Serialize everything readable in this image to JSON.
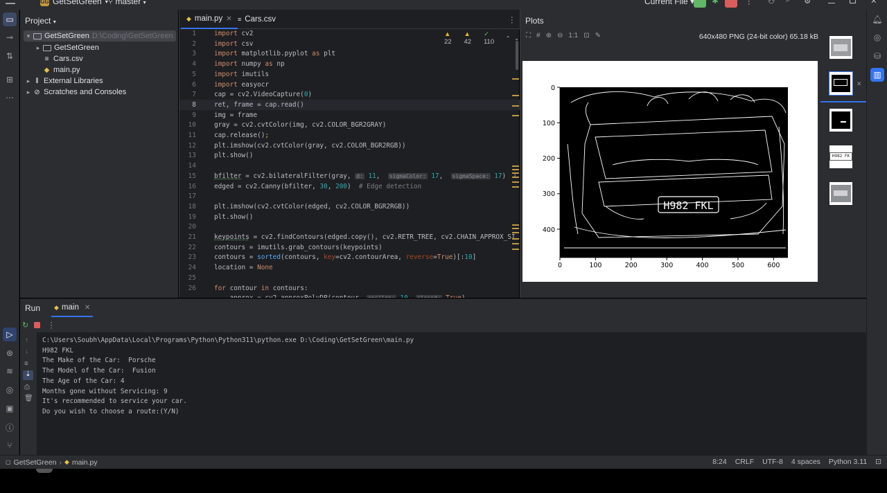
{
  "titlebar": {
    "project_badge": "GG",
    "project": "GetSetGreen",
    "branch": "master",
    "run_config": "Current File"
  },
  "project_panel": {
    "title": "Project",
    "tree": [
      {
        "label": "GetSetGreen",
        "path": "D:\\Coding\\GetSetGreen",
        "type": "folder",
        "expanded": true
      },
      {
        "label": "GetSetGreen",
        "type": "folder",
        "expanded": false
      },
      {
        "label": "Cars.csv",
        "type": "csv"
      },
      {
        "label": "main.py",
        "type": "python"
      },
      {
        "label": "External Libraries",
        "type": "library",
        "expanded": false
      },
      {
        "label": "Scratches and Consoles",
        "type": "scratch",
        "expanded": false
      }
    ]
  },
  "editor": {
    "tabs": [
      {
        "label": "main.py",
        "active": true
      },
      {
        "label": "Cars.csv",
        "active": false
      }
    ],
    "inspections": {
      "warnings": "22",
      "weak": "42",
      "ok": "110"
    },
    "current_line": 8,
    "line_numbers": [
      "1",
      "2",
      "3",
      "4",
      "5",
      "6",
      "7",
      "8",
      "9",
      "10",
      "11",
      "12",
      "13",
      "14",
      "15",
      "16",
      "17",
      "18",
      "19",
      "20",
      "21",
      "22",
      "23",
      "24",
      "25",
      "26"
    ]
  },
  "plots": {
    "title": "Plots",
    "info": "640x480 PNG (24-bit color) 65.18 kB",
    "x_ticks": [
      "0",
      "100",
      "200",
      "300",
      "400",
      "500",
      "600"
    ],
    "y_ticks": [
      "0",
      "100",
      "200",
      "300",
      "400"
    ],
    "plate_text": "H982 FKL",
    "thumb_plate": "H982 FK"
  },
  "run": {
    "tab_run": "Run",
    "tab_main": "main",
    "output": [
      "C:\\Users\\Soubh\\AppData\\Local\\Programs\\Python\\Python311\\python.exe D:\\Coding\\GetSetGreen\\main.py",
      "H982 FKL",
      "The Make of the Car:  Porsche",
      "The Model of the Car:  Fusion",
      "The Age of the Car: 4",
      "Months gone without Servicing: 9",
      "It's recommended to service your car.",
      "Do you wish to choose a route:(Y/N)"
    ]
  },
  "statusbar": {
    "crumb_project": "GetSetGreen",
    "crumb_file": "main.py",
    "position": "8:24",
    "line_sep": "CRLF",
    "encoding": "UTF-8",
    "indent": "4 spaces",
    "interpreter": "Python 3.11"
  }
}
